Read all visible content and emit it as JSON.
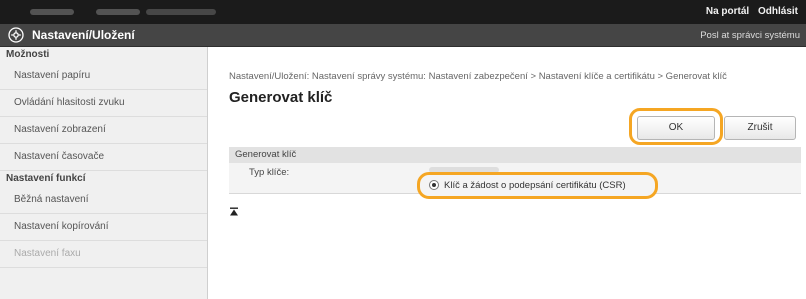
{
  "topbar": {
    "portal_link": "Na portál",
    "logout_link": "Odhlásit"
  },
  "titlebar": {
    "title": "Nastavení/Uložení",
    "admin_link": "Posl at správci systému"
  },
  "sidebar": {
    "preferences_heading": "Možnosti",
    "preferences_items": [
      "Nastavení papíru",
      "Ovládání hlasitosti zvuku",
      "Nastavení zobrazení",
      "Nastavení časovače"
    ],
    "functions_heading": "Nastavení funkcí",
    "functions_items": [
      "Běžná nastavení",
      "Nastavení kopírování",
      "Nastavení faxu"
    ]
  },
  "main": {
    "breadcrumb": "Nastavení/Uložení: Nastavení správy systému: Nastavení zabezpečení > Nastavení klíče a certifikátu > Generovat klíč",
    "page_title": "Generovat klíč",
    "ok_label": "OK",
    "cancel_label": "Zrušit",
    "panel_heading": "Generovat klíč",
    "key_type_label": "Typ klíče:",
    "key_option_label": "Klíč a žádost o podepsání certifikátu (CSR)"
  },
  "colors": {
    "highlight": "#f5a623",
    "topbar": "#1b1b1b",
    "titlebar": "#454545"
  }
}
